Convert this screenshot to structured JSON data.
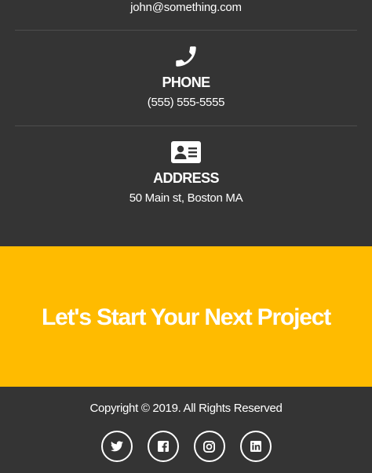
{
  "contact": {
    "email": "john@something.com",
    "phone": {
      "icon": "phone-icon",
      "title": "PHONE",
      "value": "(555) 555-5555"
    },
    "address": {
      "icon": "address-card-icon",
      "title": "ADDRESS",
      "value": "50 Main st, Boston MA"
    }
  },
  "cta": {
    "heading": "Let's Start Your Next Project",
    "background_color": "#ffbb00"
  },
  "footer": {
    "copyright": "Copyright © 2019. All Rights Reserved",
    "socials": [
      {
        "icon": "twitter-icon"
      },
      {
        "icon": "facebook-icon"
      },
      {
        "icon": "instagram-icon"
      },
      {
        "icon": "linkedin-icon"
      }
    ]
  },
  "colors": {
    "background": "#343434",
    "accent": "#ffbb00",
    "text": "#ffffff",
    "divider": "#4d4d4d"
  }
}
